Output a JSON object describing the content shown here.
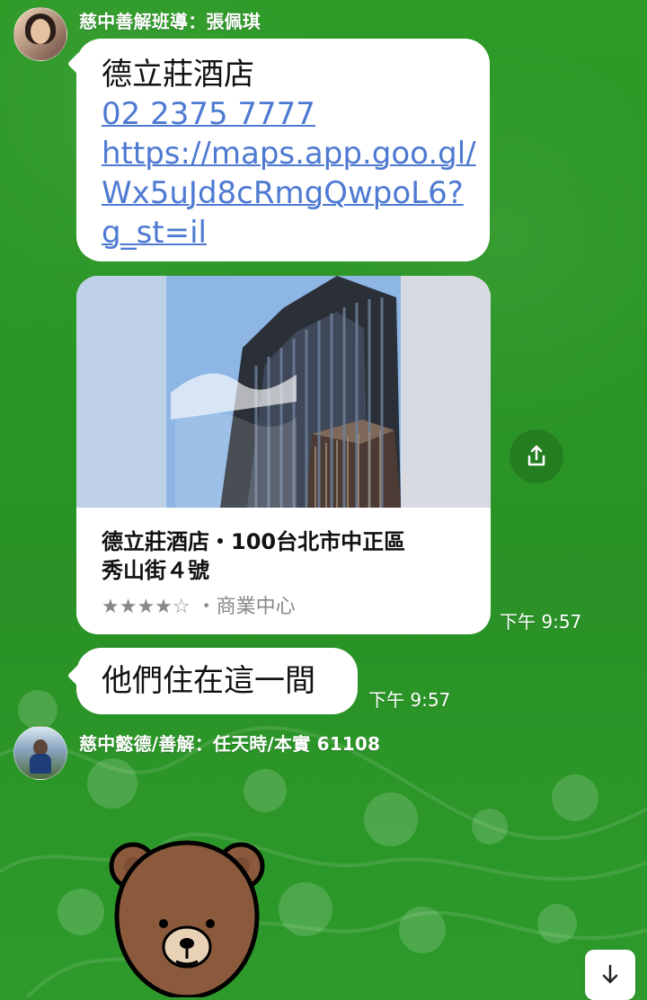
{
  "chat": {
    "messages": [
      {
        "sender": "慈中善解班導：張佩琪",
        "lines": [
          "德立莊酒店",
          "02 2375 7777",
          "https://maps.app.goo.gl/",
          "Wx5uJd8cRmgQwpoL6?",
          "g_st=il"
        ]
      },
      {
        "card": {
          "title_line1": "德立莊酒店・100台北市中正區",
          "title_line2": "秀山街４號",
          "rating": "★★★★☆",
          "category": "・商業中心"
        },
        "time": "下午 9:57"
      },
      {
        "text": "他們住在這一間",
        "time": "下午 9:57"
      },
      {
        "sender": "慈中懿德/善解：任天時/本實 61108"
      }
    ]
  },
  "icons": {
    "share": "share-icon",
    "scroll_down": "arrow-down-icon"
  },
  "colors": {
    "background": "#2f9a2b",
    "link": "#4e7ad2",
    "bubble": "#ffffff",
    "meta": "#888888"
  }
}
